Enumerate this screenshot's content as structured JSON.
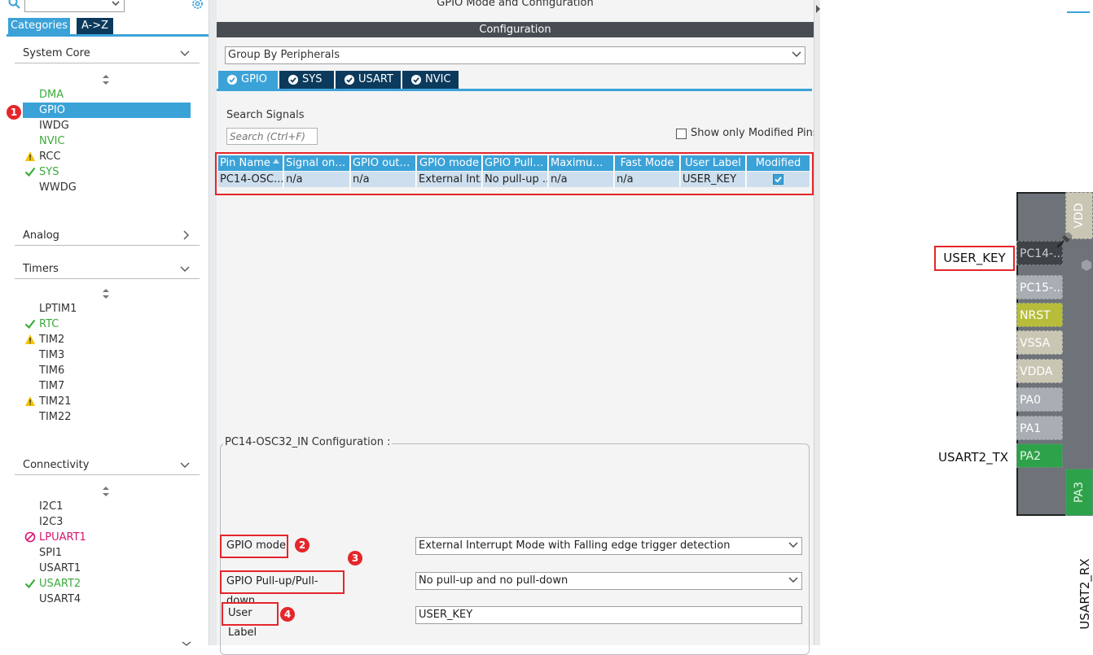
{
  "left_panel": {
    "category_select_value": "",
    "view_tabs": {
      "categories": "Categories",
      "az": "A->Z"
    },
    "sections": {
      "system_core": {
        "title": "System Core",
        "items": [
          "DMA",
          "GPIO",
          "IWDG",
          "NVIC",
          "RCC",
          "SYS",
          "WWDG"
        ]
      },
      "analog": {
        "title": "Analog"
      },
      "timers": {
        "title": "Timers",
        "items": [
          "LPTIM1",
          "RTC",
          "TIM2",
          "TIM3",
          "TIM6",
          "TIM7",
          "TIM21",
          "TIM22"
        ]
      },
      "connectivity": {
        "title": "Connectivity",
        "items": [
          "I2C1",
          "I2C3",
          "LPUART1",
          "SPI1",
          "USART1",
          "USART2",
          "USART4"
        ]
      }
    }
  },
  "main": {
    "title": "GPIO Mode and Configuration",
    "config_bar": "Configuration",
    "group_select": "Group By Peripherals",
    "tabs": [
      "GPIO",
      "SYS",
      "USART",
      "NVIC"
    ],
    "search": {
      "label": "Search Signals",
      "placeholder": "Search (Ctrl+F)"
    },
    "show_modified_label": "Show only Modified Pins",
    "table": {
      "columns": [
        "Pin Name",
        "Signal on Pin",
        "GPIO outp...",
        "GPIO mode",
        "GPIO Pull-...",
        "Maximum ...",
        "Fast Mode",
        "User Label",
        "Modified"
      ],
      "rows": [
        [
          "PC14-OSC...",
          "n/a",
          "n/a",
          "External Int...",
          "No pull-up ...",
          "n/a",
          "n/a",
          "USER_KEY",
          "checked"
        ]
      ]
    },
    "pin_config": {
      "title": "PC14-OSC32_IN Configuration :",
      "gpio_mode": {
        "label": "GPIO mode",
        "value": "External Interrupt Mode with Falling edge trigger detection"
      },
      "pull": {
        "label": "GPIO Pull-up/Pull-down",
        "value": "No pull-up and no pull-down"
      },
      "user_label": {
        "label": "User Label",
        "value": "USER_KEY"
      }
    }
  },
  "annotations": [
    "1",
    "2",
    "3",
    "4"
  ],
  "chip": {
    "pins": [
      "PC14-...",
      "PC15-...",
      "NRST",
      "VSSA",
      "VDDA",
      "PA0",
      "PA1",
      "PA2"
    ],
    "vertical_pins": [
      "VDD",
      "PA3"
    ],
    "labels": {
      "pc14": "USER_KEY",
      "pa2": "USART2_TX",
      "pa3": "USART2_RX"
    }
  },
  "colors": {
    "accent": "#3ba2d8",
    "tab_dark": "#0c3a5c",
    "highlight": "#e4262b",
    "ok_green": "#3bab3b",
    "warn": "#f5c400",
    "error": "#d6146f"
  }
}
